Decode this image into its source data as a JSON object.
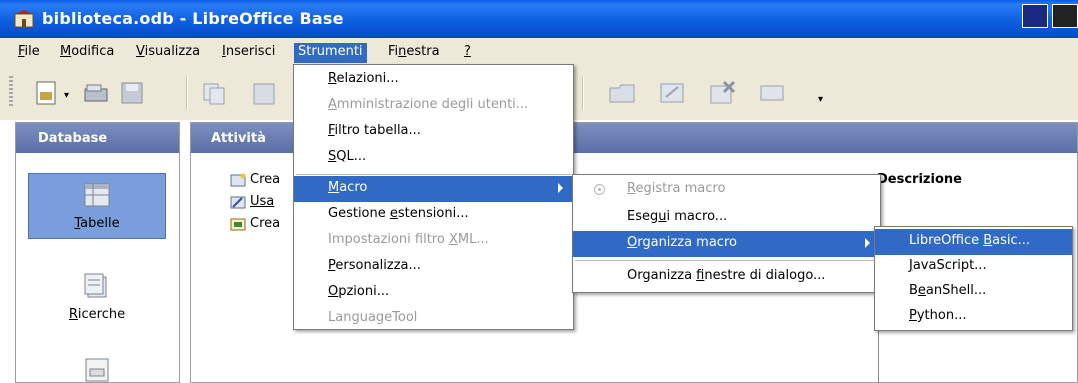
{
  "window": {
    "title": "biblioteca.odb - LibreOffice Base"
  },
  "menubar": {
    "items": [
      {
        "label": "File",
        "u": "F",
        "rest": "ile"
      },
      {
        "label": "Modifica",
        "u": "M",
        "rest": "odifica"
      },
      {
        "label": "Visualizza",
        "u": "V",
        "rest": "isualizza"
      },
      {
        "label": "Inserisci",
        "u": "I",
        "rest": "nserisci"
      },
      {
        "label": "Strumenti"
      },
      {
        "pre": "Fi",
        "u": "n",
        "rest": "estra"
      },
      {
        "label": "?"
      }
    ]
  },
  "panels": {
    "database_title": "Database",
    "activity_title": "Attività",
    "description_title": "Descrizione",
    "db_items": [
      {
        "u": "T",
        "rest": "abelle"
      },
      {
        "u": "R",
        "rest": "icerche"
      }
    ],
    "tasks": [
      "Crea",
      "Usa",
      "Crea"
    ]
  },
  "strumenti_menu": {
    "items": [
      {
        "u": "R",
        "rest": "elazioni..."
      },
      {
        "u": "A",
        "rest": "mministrazione degli utenti..."
      },
      {
        "u": "F",
        "rest": "iltro tabella..."
      },
      {
        "u": "S",
        "rest": "QL..."
      },
      {
        "u": "M",
        "rest": "acro"
      },
      {
        "pre": "Gestione ",
        "u": "e",
        "rest": "stensioni..."
      },
      {
        "pre": "Impostazioni filtro ",
        "u": "X",
        "rest": "ML..."
      },
      {
        "u": "P",
        "rest": "ersonalizza..."
      },
      {
        "u": "O",
        "rest": "pzioni..."
      },
      {
        "label": "LanguageTool"
      }
    ]
  },
  "macro_menu": {
    "items": [
      {
        "u": "R",
        "rest": "egistra macro"
      },
      {
        "pre": "Eseg",
        "u": "u",
        "rest": "i macro..."
      },
      {
        "u": "O",
        "rest": "rganizza macro"
      },
      {
        "pre": "Organizza ",
        "u": "f",
        "rest": "inestre di dialogo..."
      }
    ]
  },
  "organizza_menu": {
    "items": [
      {
        "pre": "LibreOffice ",
        "u": "B",
        "rest": "asic..."
      },
      {
        "u": "J",
        "rest": "avaScript..."
      },
      {
        "pre": "B",
        "u": "e",
        "rest": "anShell..."
      },
      {
        "u": "P",
        "rest": "ython..."
      }
    ]
  }
}
